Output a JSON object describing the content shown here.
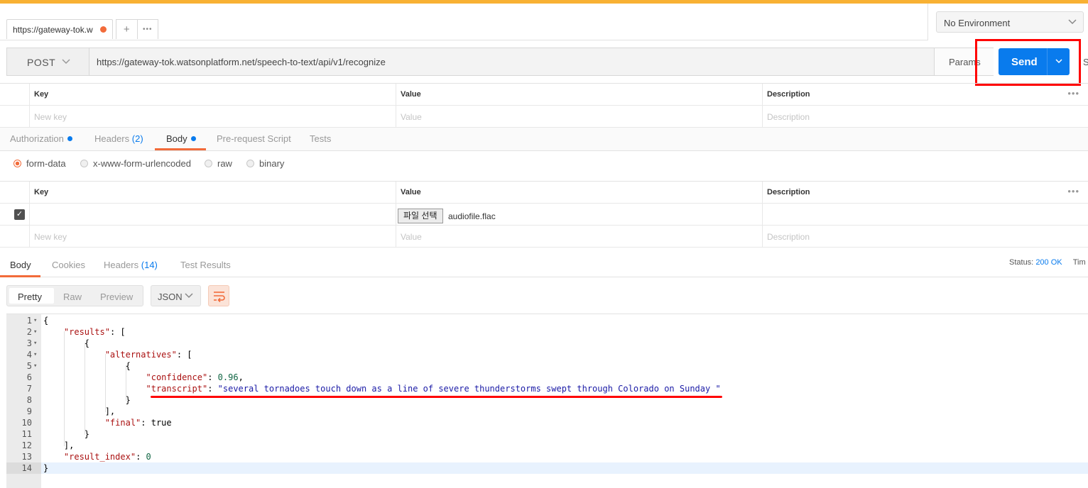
{
  "tab": {
    "title": "https://gateway-tok.w",
    "add": "+",
    "more": "•••"
  },
  "environment": {
    "selected": "No Environment",
    "chevron": "chevron-down-icon"
  },
  "request": {
    "method": "POST",
    "url": "https://gateway-tok.watsonplatform.net/speech-to-text/api/v1/recognize",
    "params_label": "Params",
    "send_label": "Send",
    "save_peek": "S"
  },
  "params_table": {
    "headers": {
      "key": "Key",
      "value": "Value",
      "description": "Description"
    },
    "placeholders": {
      "key": "New key",
      "value": "Value",
      "description": "Description"
    }
  },
  "request_tabs": [
    {
      "label": "Authorization",
      "dot": true
    },
    {
      "label": "Headers",
      "count": "(2)"
    },
    {
      "label": "Body",
      "dot": true,
      "active": true
    },
    {
      "label": "Pre-request Script"
    },
    {
      "label": "Tests"
    }
  ],
  "body_types": [
    "form-data",
    "x-www-form-urlencoded",
    "raw",
    "binary"
  ],
  "body_type_selected": "form-data",
  "form_table": {
    "headers": {
      "key": "Key",
      "value": "Value",
      "description": "Description"
    },
    "row": {
      "checked": true,
      "file_button": "파일 선택",
      "file_name": "audiofile.flac"
    },
    "placeholders": {
      "key": "New key",
      "value": "Value",
      "description": "Description"
    }
  },
  "response_tabs": [
    {
      "label": "Body",
      "active": true
    },
    {
      "label": "Cookies"
    },
    {
      "label": "Headers",
      "count": "(14)"
    },
    {
      "label": "Test Results"
    }
  ],
  "status": {
    "label": "Status:",
    "value": "200 OK",
    "time_peek": "Tim"
  },
  "view_modes": [
    "Pretty",
    "Raw",
    "Preview"
  ],
  "view_mode_selected": "Pretty",
  "format": "JSON",
  "code_lines": [
    "{",
    "    \"results\": [",
    "        {",
    "            \"alternatives\": [",
    "                {",
    "                    \"confidence\": 0.96,",
    "                    \"transcript\": \"several tornadoes touch down as a line of severe thunderstorms swept through Colorado on Sunday \"",
    "                }",
    "            ],",
    "            \"final\": true",
    "        }",
    "    ],",
    "    \"result_index\": 0",
    "}"
  ],
  "fold_lines": [
    1,
    2,
    3,
    4,
    5
  ],
  "highlighted_line": 14,
  "colors": {
    "accent": "#f26b3a",
    "send": "#097bed",
    "annotation": "#ff0000",
    "topbar": "#f8b133"
  }
}
